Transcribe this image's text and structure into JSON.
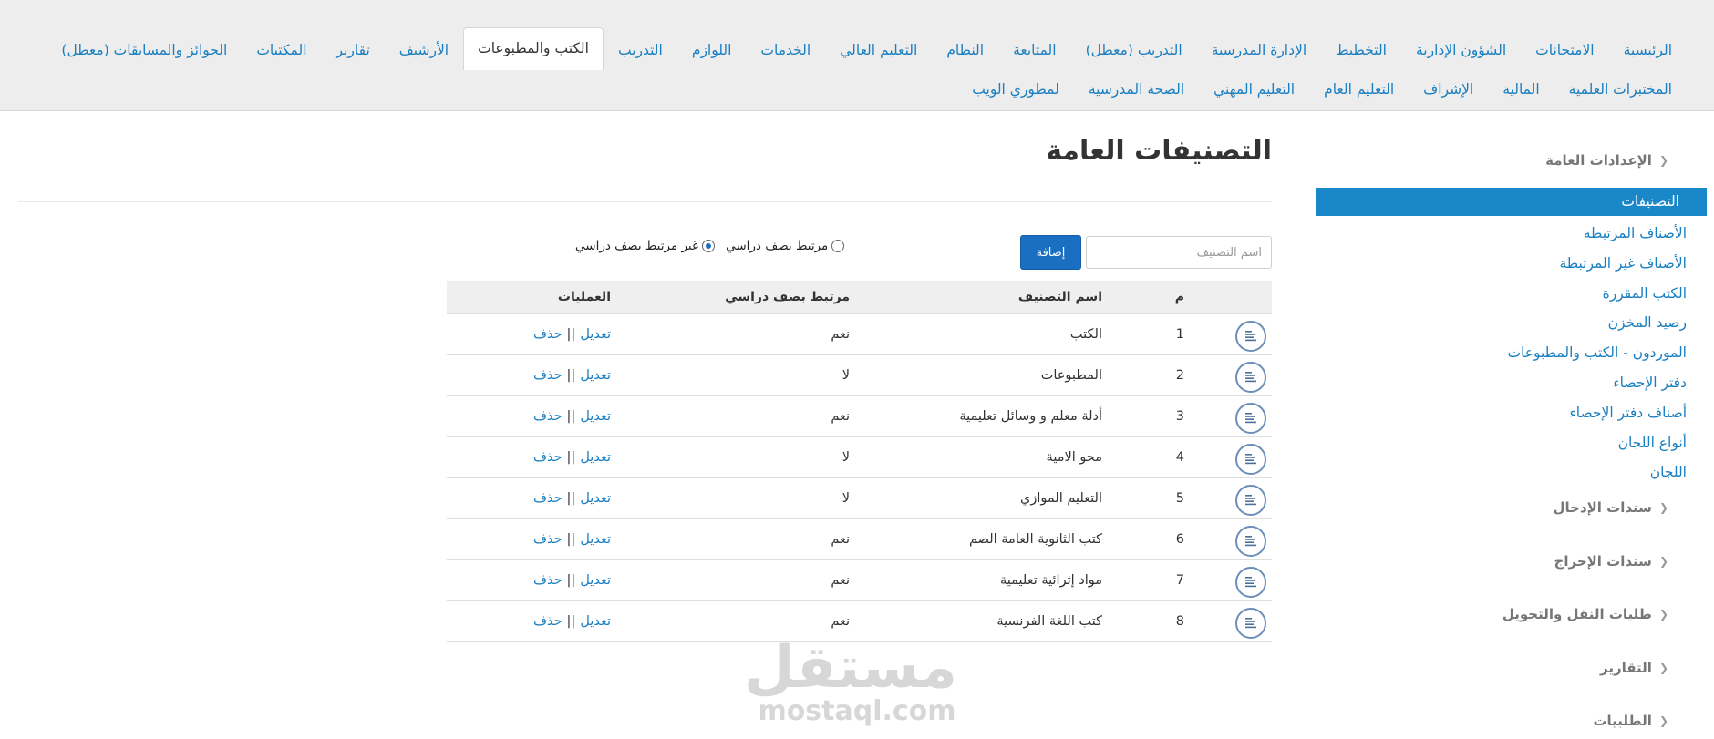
{
  "topnav": {
    "row1": [
      "الرئيسية",
      "الامتحانات",
      "الشؤون الإدارية",
      "التخطيط",
      "الإدارة المدرسية",
      "التدريب (معطل)",
      "المتابعة",
      "النظام",
      "التعليم العالي",
      "الخدمات",
      "اللوازم",
      "التدريب",
      "الكتب والمطبوعات",
      "الأرشيف",
      "تقارير",
      "المكتبات",
      "الجوائز والمسابقات (معطل)"
    ],
    "row2": [
      "المختبرات العلمية",
      "المالية",
      "الإشراف",
      "التعليم العام",
      "التعليم المهني",
      "الصحة المدرسية",
      "لمطوري الويب"
    ],
    "active": "الكتب والمطبوعات"
  },
  "sidebar": {
    "group_general": "الإعدادات العامة",
    "active_item": "التصنيفات",
    "links": [
      "الأصناف المرتبطة",
      "الأصناف غير المرتبطة",
      "الكتب المقررة",
      "رصيد المخزن",
      "الموردون - الكتب والمطبوعات",
      "دفتر الإحصاء",
      "أصناف دفتر الإحصاء",
      "أنواع اللجان",
      "اللجان"
    ],
    "groups": [
      "سندات الإدخال",
      "سندات الإخراج",
      "طلبات النقل والتحويل",
      "التقارير",
      "الطلبيات"
    ]
  },
  "main": {
    "title": "التصنيفات العامة",
    "input_placeholder": "اسم التصنيف",
    "add_button": "إضافة",
    "radio_linked": "مرتبط بصف دراسي",
    "radio_unlinked": "غير مرتبط بصف دراسي",
    "radio_selected": "unlinked"
  },
  "table": {
    "headers": {
      "num": "م",
      "name": "اسم التصنيف",
      "linked": "مرتبط بصف دراسي",
      "ops": "العمليات"
    },
    "edit_label": "تعديل",
    "delete_label": "حذف",
    "separator": "||",
    "rows": [
      {
        "num": "1",
        "name": "الكتب",
        "linked": "نعم"
      },
      {
        "num": "2",
        "name": "المطبوعات",
        "linked": "لا"
      },
      {
        "num": "3",
        "name": "أدلة معلم و وسائل تعليمية",
        "linked": "نعم"
      },
      {
        "num": "4",
        "name": "محو الامية",
        "linked": "لا"
      },
      {
        "num": "5",
        "name": "التعليم الموازي",
        "linked": "لا"
      },
      {
        "num": "6",
        "name": "كتب الثانوية العامة الصم",
        "linked": "نعم"
      },
      {
        "num": "7",
        "name": "مواد إثرائية تعليمية",
        "linked": "نعم"
      },
      {
        "num": "8",
        "name": "كتب اللغة الفرنسية",
        "linked": "نعم"
      }
    ]
  },
  "watermark": {
    "ar": "مستقل",
    "en": "mostaql.com"
  }
}
